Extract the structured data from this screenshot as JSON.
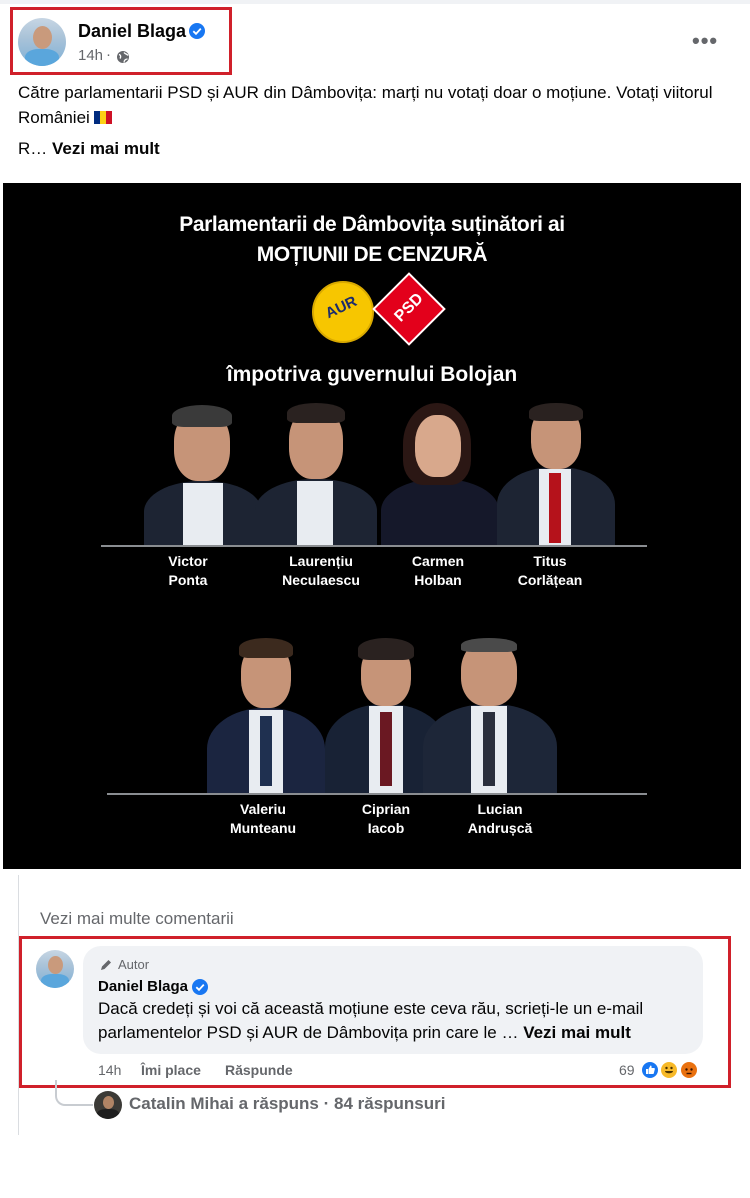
{
  "post": {
    "author": "Daniel Blaga",
    "time": "14h",
    "text_line1": "Către parlamentarii PSD și AUR din Dâmbovița: marți nu votați doar o moțiune. Votați viitorul României",
    "text_truncated": "R…",
    "see_more": "Vezi mai mult",
    "more_options": "•••"
  },
  "poster": {
    "title_line1": "Parlamentarii de Dâmbovița suținători ai",
    "title_line2": "MOȚIUNII DE CENZURĂ",
    "aur_logo_text": "AUR",
    "psd_logo_text": "PSD",
    "subtitle": "împotriva guvernului Bolojan",
    "row1": [
      {
        "first": "Victor",
        "last": "Ponta"
      },
      {
        "first": "Laurențiu",
        "last": "Neculaescu"
      },
      {
        "first": "Carmen",
        "last": "Holban"
      },
      {
        "first": "Titus",
        "last": "Corlățean"
      }
    ],
    "row2": [
      {
        "first": "Valeriu",
        "last": "Munteanu"
      },
      {
        "first": "Ciprian",
        "last": "Iacob"
      },
      {
        "first": "Lucian",
        "last": "Andrușcă"
      }
    ]
  },
  "comments": {
    "view_more": "Vezi mai multe comentarii",
    "author_badge": "Autor",
    "author": "Daniel Blaga",
    "text": "Dacă credeți și voi că această moțiune este ceva rău, scrieți-le un e-mail parlamentelor PSD și AUR de Dâmbovița prin care le …",
    "see_more": "Vezi mai mult",
    "time": "14h",
    "like": "Îmi place",
    "reply": "Răspunde",
    "reaction_count": "69",
    "replies_text": "Catalin Mihai a răspuns · 84 răspunsuri"
  },
  "colors": {
    "highlight": "#d0202a",
    "verified": "#1877f2",
    "secondary_text": "#65676b"
  }
}
